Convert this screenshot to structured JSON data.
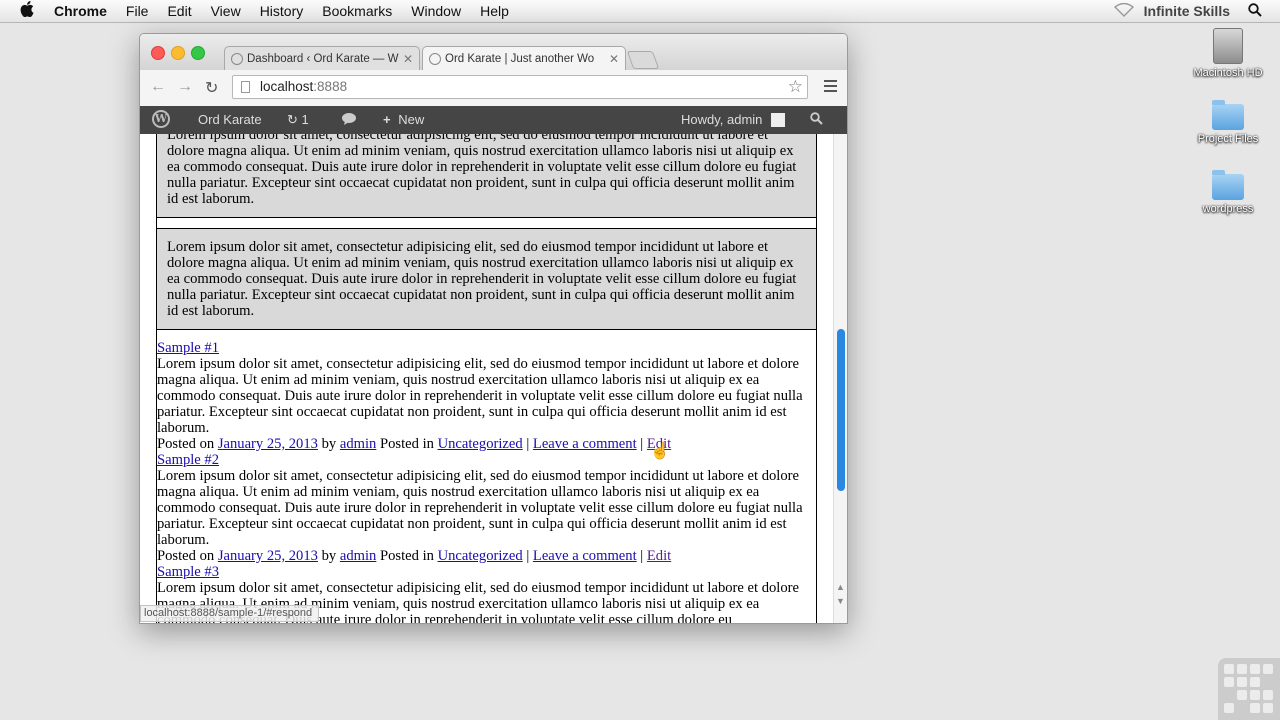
{
  "menubar": {
    "apple_icon": "apple-icon",
    "items": [
      "Chrome",
      "File",
      "Edit",
      "View",
      "History",
      "Bookmarks",
      "Window",
      "Help"
    ],
    "brand": "Infinite Skills",
    "wifi_icon": "wifi-icon",
    "search_icon": "spotlight-icon"
  },
  "desktop": {
    "icons": [
      {
        "label": "Macintosh HD",
        "icon": "hard-drive-icon"
      },
      {
        "label": "Project Files",
        "icon": "folder-icon"
      },
      {
        "label": "wordpress",
        "icon": "folder-icon"
      }
    ]
  },
  "browser": {
    "tabs": [
      {
        "title": "Dashboard ‹ Ord Karate — W",
        "active": false
      },
      {
        "title": "Ord Karate | Just another Wo",
        "active": true
      }
    ],
    "url_host": "localhost",
    "url_port": ":8888",
    "status_text": "localhost:8888/sample-1/#respond"
  },
  "adminbar": {
    "site_name": "Ord Karate",
    "updates_count": "1",
    "new_label": "New",
    "howdy": "Howdy, admin"
  },
  "content": {
    "box_text": "Lorem ipsum dolor sit amet, consectetur adipisicing elit, sed do eiusmod tempor incididunt ut labore et dolore magna aliqua. Ut enim ad minim veniam, quis nostrud exercitation ullamco laboris nisi ut aliquip ex ea commodo consequat. Duis aute irure dolor in reprehenderit in voluptate velit esse cillum dolore eu fugiat nulla pariatur. Excepteur sint occaecat cupidatat non proident, sunt in culpa qui officia deserunt mollit anim id est laborum.",
    "box1_partial": "Lorem ipsum dolor sit amet, consectetur adipisicing elit, sed do eiusmod tempor incididunt ut labore et dolore magna aliqua. Ut enim ad minim veniam, quis nostrud exercitation ullamco laboris nisi ut aliquip ex ea commodo consequat. Duis aute irure dolor in reprehenderit in voluptate velit esse cillum dolore eu fugiat nulla pariatur. Excepteur sint occaecat cupidatat non proident, sunt in culpa qui officia deserunt mollit anim id est laborum.",
    "posts": [
      {
        "title": "Sample #1",
        "body": "Lorem ipsum dolor sit amet, consectetur adipisicing elit, sed do eiusmod tempor incididunt ut labore et dolore magna aliqua. Ut enim ad minim veniam, quis nostrud exercitation ullamco laboris nisi ut aliquip ex ea commodo consequat. Duis aute irure dolor in reprehenderit in voluptate velit esse cillum dolore eu fugiat nulla pariatur. Excepteur sint occaecat cupidatat non proident, sunt in culpa qui officia deserunt mollit anim id est laborum.",
        "posted_on": "Posted on",
        "date": "January 25, 2013",
        "by": "by",
        "author": "admin",
        "posted_in": "Posted in",
        "category": "Uncategorized",
        "sep": "|",
        "comment": "Leave a comment",
        "edit": "Edit"
      },
      {
        "title": "Sample #2",
        "body": "Lorem ipsum dolor sit amet, consectetur adipisicing elit, sed do eiusmod tempor incididunt ut labore et dolore magna aliqua. Ut enim ad minim veniam, quis nostrud exercitation ullamco laboris nisi ut aliquip ex ea commodo consequat. Duis aute irure dolor in reprehenderit in voluptate velit esse cillum dolore eu fugiat nulla pariatur. Excepteur sint occaecat cupidatat non proident, sunt in culpa qui officia deserunt mollit anim id est laborum.",
        "posted_on": "Posted on",
        "date": "January 25, 2013",
        "by": "by",
        "author": "admin",
        "posted_in": "Posted in",
        "category": "Uncategorized",
        "sep": "|",
        "comment": "Leave a comment",
        "edit": "Edit"
      },
      {
        "title": "Sample #3",
        "body": "Lorem ipsum dolor sit amet, consectetur adipisicing elit, sed do eiusmod tempor incididunt ut labore et dolore magna aliqua. Ut enim ad minim veniam, quis nostrud exercitation ullamco laboris nisi ut aliquip ex ea commodo consequat. Duis aute irure dolor in reprehenderit in voluptate velit esse cillum dolore eu"
      }
    ]
  },
  "colors": {
    "link": "#1a0dab",
    "visited": "#551a8b",
    "scroll_thumb": "#2a88e0",
    "adminbar_bg": "#454545"
  }
}
